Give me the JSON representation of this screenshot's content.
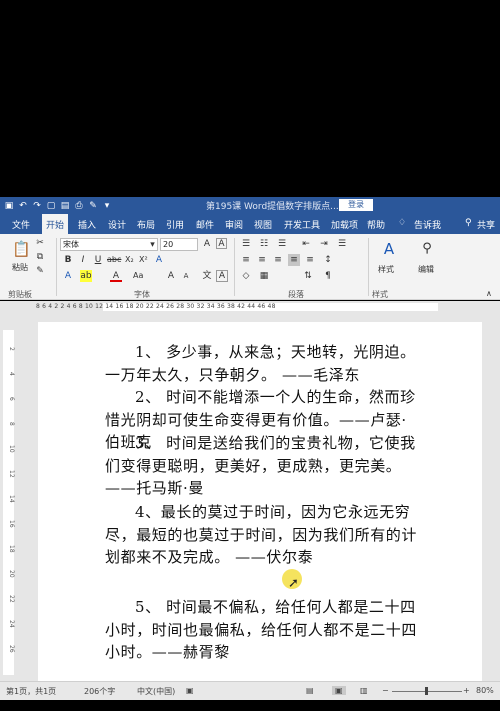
{
  "titlebar": {
    "doc_title": "第195课 Word提倡数字排版点...",
    "login_label": "登录"
  },
  "tabs": [
    {
      "label": "文件"
    },
    {
      "label": "开始"
    },
    {
      "label": "插入"
    },
    {
      "label": "设计"
    },
    {
      "label": "布局"
    },
    {
      "label": "引用"
    },
    {
      "label": "邮件"
    },
    {
      "label": "审阅"
    },
    {
      "label": "视图"
    },
    {
      "label": "开发工具"
    },
    {
      "label": "加载项"
    },
    {
      "label": "帮助"
    },
    {
      "label": "告诉我"
    },
    {
      "label": "共享"
    }
  ],
  "ribbon": {
    "paste_label": "粘贴",
    "font_name": "宋体",
    "font_size": "20",
    "style_label": "样式",
    "edit_label": "编辑",
    "groups": {
      "clipboard": "剪贴板",
      "font": "字体",
      "paragraph": "段落",
      "styles": "样式"
    }
  },
  "ruler": {
    "numbers": "8  6  4  2       2  4  6  8  10  12  14  16  18  20  22  24  26  28  30  32  34  36  38       42  44  46  48"
  },
  "vruler": [
    "2",
    "4",
    "6",
    "8",
    "10",
    "12",
    "14",
    "16",
    "18",
    "20",
    "22",
    "24",
    "26"
  ],
  "document": {
    "paragraphs": [
      "1、 多少事，从来急；天地转，光阴迫。一万年太久，只争朝夕。 ——毛泽东",
      "2、 时间不能增添一个人的生命，然而珍惜光阴却可使生命变得更有价值。——卢瑟·伯班克",
      "3、 时间是送给我们的宝贵礼物，它使我们变得更聪明，更美好，更成熟，更完美。——托马斯·曼",
      "4、最长的莫过于时间，因为它永远无穷尽，最短的也莫过于时间，因为我们所有的计划都来不及完成。 ——伏尔泰",
      "5、 时间最不偏私，给任何人都是二十四小时，时间也最偏私，给任何人都不是二十四小时。——赫胥黎"
    ]
  },
  "statusbar": {
    "page": "第1页，共1页",
    "words": "206个字",
    "language": "中文(中国)",
    "zoom": "80%"
  },
  "colors": {
    "accent": "#2b579a",
    "ribbon_bg": "#f3f3f3",
    "cursor_highlight": "#f4e04d"
  }
}
